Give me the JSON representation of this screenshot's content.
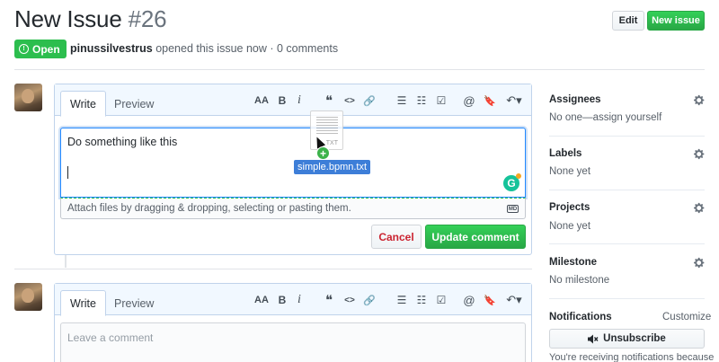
{
  "header": {
    "title": "New Issue",
    "number": "#26",
    "edit_label": "Edit",
    "new_issue_label": "New issue"
  },
  "issue_meta": {
    "state": "Open",
    "author": "pinussilvestrus",
    "summary": "opened this issue now · 0 comments"
  },
  "editor1": {
    "tab_write": "Write",
    "tab_preview": "Preview",
    "text": "Do something like this",
    "attach_hint": "Attach files by dragging & dropping, selecting or pasting them.",
    "markdown_icon": "MD",
    "cancel_label": "Cancel",
    "update_label": "Update comment",
    "grammarly_letter": "G"
  },
  "toolbar": {
    "heading": "AA",
    "bold": "B",
    "italic": "i",
    "quote": "❝",
    "code": "<>",
    "link": "🔗",
    "bullet_list": "☰",
    "numbered_list": "☷",
    "task_list": "☑",
    "mention": "@",
    "saved_reply": "🔖",
    "reply": "↶▾"
  },
  "drag": {
    "file_ext": "TXT",
    "filename": "simple.bpmn.txt",
    "plus": "+"
  },
  "editor2": {
    "tab_write": "Write",
    "tab_preview": "Preview",
    "placeholder": "Leave a comment"
  },
  "sidebar": {
    "assignees_title": "Assignees",
    "assignees_value": "No one—assign yourself",
    "labels_title": "Labels",
    "labels_value": "None yet",
    "projects_title": "Projects",
    "projects_value": "None yet",
    "milestone_title": "Milestone",
    "milestone_value": "No milestone",
    "notifications_title": "Notifications",
    "customize_label": "Customize",
    "unsubscribe_label": "Unsubscribe",
    "notif_text": "You're receiving notifications because"
  },
  "colors": {
    "green": "#2cbe4e",
    "blue_border": "#c0d3eb",
    "focus_blue": "#2188ff",
    "cancel_red": "#cb2431"
  }
}
